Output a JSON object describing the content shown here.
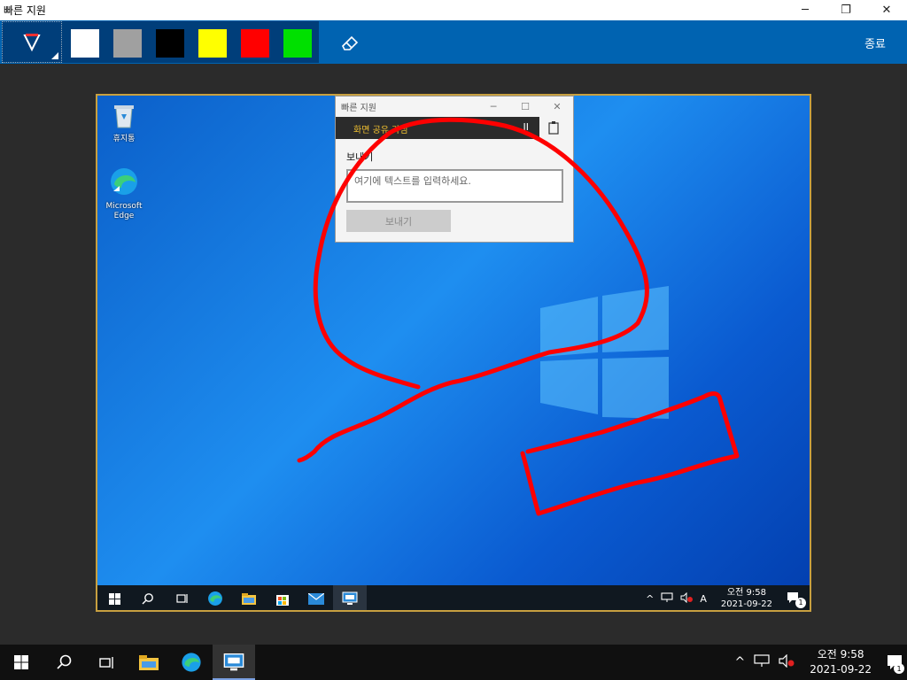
{
  "window": {
    "title": "빠른 지원",
    "minimize": "─",
    "restore": "❐",
    "close": "✕"
  },
  "toolbar": {
    "colors": [
      {
        "name": "white",
        "hex": "#ffffff"
      },
      {
        "name": "gray",
        "hex": "#a0a0a0"
      },
      {
        "name": "black",
        "hex": "#000000"
      },
      {
        "name": "yellow",
        "hex": "#ffff00"
      },
      {
        "name": "red",
        "hex": "#ff0000"
      },
      {
        "name": "green",
        "hex": "#00e000"
      }
    ],
    "exit_label": "종료"
  },
  "desktop": {
    "icons": [
      {
        "label": "휴지통",
        "icon": "recycle-bin-icon"
      },
      {
        "label": "Microsoft Edge",
        "icon": "edge-icon"
      }
    ]
  },
  "quick_assist": {
    "title": "빠른 지원",
    "min": "─",
    "max": "☐",
    "close": "✕",
    "status": "화면 공유 가짐",
    "pause": "II",
    "send_label": "보내기",
    "input_placeholder": "여기에 텍스트를 입력하세요.",
    "send_button": "보내기"
  },
  "inner_taskbar": {
    "tray_up": "^",
    "ime": "A",
    "time": "오전 9:58",
    "date": "2021-09-22",
    "badge": "1"
  },
  "taskbar": {
    "tray_up": "^",
    "time": "오전 9:58",
    "date": "2021-09-22",
    "badge": "1"
  }
}
